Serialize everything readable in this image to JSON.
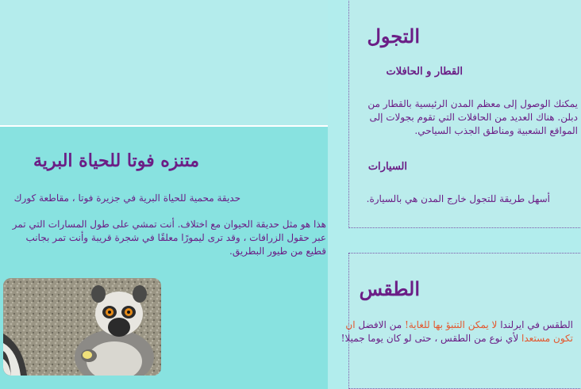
{
  "travel": {
    "title": "التجول",
    "train_heading": "القطار و الحافلات",
    "train_text": "يمكنك الوصول إلى معظم المدن الرئيسية بالقطار من دبلن. هناك العديد من الحافلات التي تقوم بجولات إلى المواقع الشعبية ومناطق الجذب السياحي.",
    "cars_heading": "السيارات",
    "cars_text": "أسهل طريقة للتجول خارج المدن هي بالسيارة."
  },
  "weather": {
    "title": "الطقس",
    "text_1": "الطقس في ايرلندا",
    "highlight_1": "لا يمكن التنبؤ بها للغاية!",
    "text_2": "من الافضل",
    "highlight_2": "ان تكون مستعدا",
    "text_3": "لأي نوع من الطقس ، حتى لو كان يوما جميلا!"
  },
  "zoo": {
    "title": "متنزه فوتا للحياة البرية",
    "subtitle": "حديقة محمية للحياة البرية في جزيرة فوتا ، مقاطعة كورك",
    "description": "هذا هو مثل حديقة الحيوان مع اختلاف. أنت تمشي على طول المسارات التي تمر عبر حقول الزرافات ، وقد ترى ليمورًا معلقًا في شجرة قريبة وأنت تمر بجانب قطيع من طيور البطريق.",
    "image_alt": "lemur"
  },
  "colors": {
    "background": "#b2eded",
    "card": "#88e2e0",
    "text": "#6b1e86",
    "highlight": "#e4572e"
  }
}
